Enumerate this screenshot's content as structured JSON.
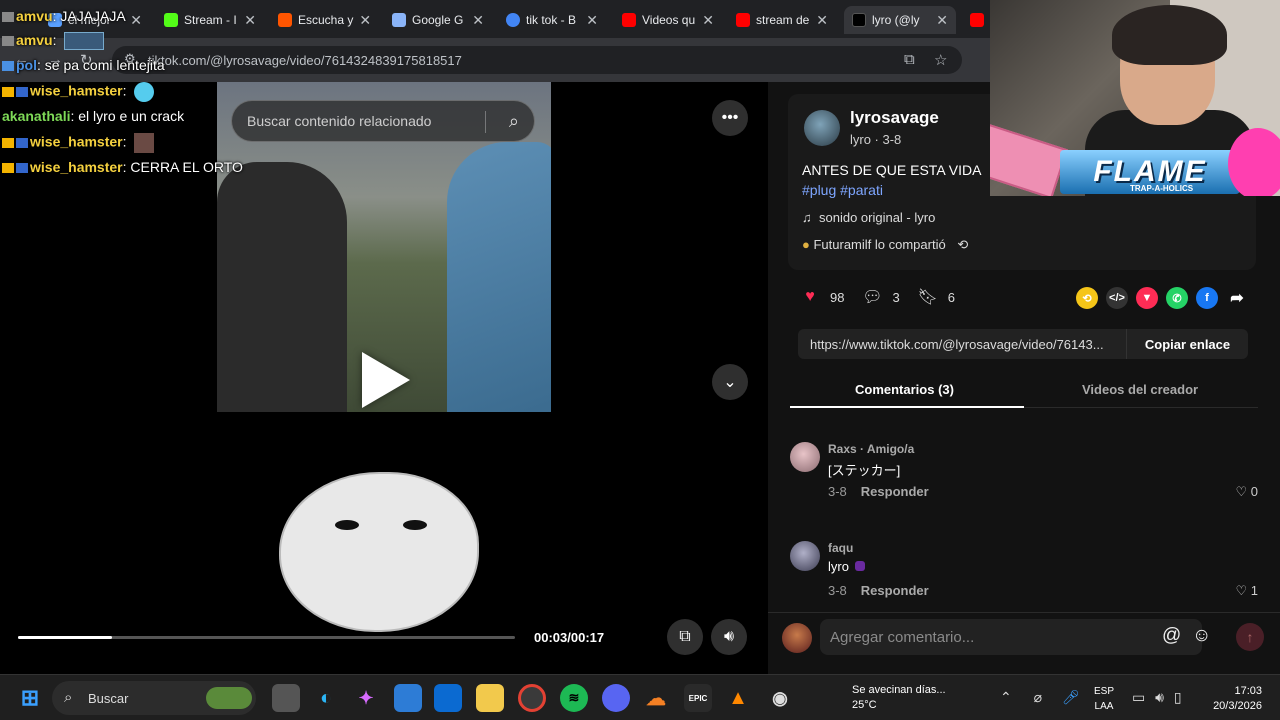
{
  "browser": {
    "tabs": [
      {
        "label": "el mejor",
        "color": "#5aa0ff"
      },
      {
        "label": "Stream - I",
        "color": "#53fc18"
      },
      {
        "label": "Escucha y",
        "color": "#ff5500"
      },
      {
        "label": "Google G",
        "color": "#8ab4f8"
      },
      {
        "label": "tik tok - B",
        "color": "#4285f4"
      },
      {
        "label": "Videos qu",
        "color": "#ff0000"
      },
      {
        "label": "stream de",
        "color": "#ff0000"
      },
      {
        "label": "lyro (@ly",
        "color": "#ffffff"
      },
      {
        "label": "",
        "color": "#ff0000"
      }
    ],
    "url": "tiktok.com/@lyrosavage/video/7614324839175818517"
  },
  "chat": [
    {
      "user": "amvu",
      "text": ": JAJAJAJA",
      "color": "#f4d03f"
    },
    {
      "user": "amvu",
      "text": ":",
      "color": "#f4d03f"
    },
    {
      "user": "pol",
      "text": ": se pa comi lentejita",
      "color": "#4a90e2"
    },
    {
      "user": "wise_hamster",
      "text": ":",
      "color": "#f4d03f"
    },
    {
      "user": "akanathali",
      "text": ": el lyro e un crack",
      "color": "#7ed957"
    },
    {
      "user": "wise_hamster",
      "text": ":",
      "color": "#f4d03f"
    },
    {
      "user": "wise_hamster",
      "text": ": CERRA EL ORTO",
      "color": "#f4d03f"
    }
  ],
  "player": {
    "search_placeholder": "Buscar contenido relacionado",
    "time": "00:03/00:17",
    "progress": 0.19
  },
  "post": {
    "username": "lyrosavage",
    "subline": "lyro · 3-8",
    "caption": "ANTES DE QUE ESTA VIDA",
    "tags": "#plug #parati",
    "music": "sonido original - lyro",
    "shared": "Futuramilf lo compartió",
    "likes": "98",
    "comments": "3",
    "saves": "6",
    "link": "https://www.tiktok.com/@lyrosavage/video/76143...",
    "copy_label": "Copiar enlace"
  },
  "tabs": {
    "comments": "Comentarios (3)",
    "creator": "Videos del creador"
  },
  "comments": [
    {
      "name": "Raxs · Amigo/a",
      "text": "[ステッカー]",
      "date": "3-8",
      "reply": "Responder",
      "likes": "0",
      "avatar": "#c9a0a8"
    },
    {
      "name": "faqu",
      "text": "lyro",
      "date": "3-8",
      "reply": "Responder",
      "likes": "1",
      "avatar": "#6a6a80"
    }
  ],
  "compose": {
    "placeholder": "Agregar comentario..."
  },
  "overlay": {
    "brand": "FLAME",
    "brand_sub": "TRAP-A-HOLICS"
  },
  "taskbar": {
    "search": "Buscar",
    "weather_line1": "Se avecinan días...",
    "weather_line2": "25°C",
    "lang_line1": "ESP",
    "lang_line2": "LAA",
    "time": "17:03",
    "date": "20/3/2026"
  }
}
